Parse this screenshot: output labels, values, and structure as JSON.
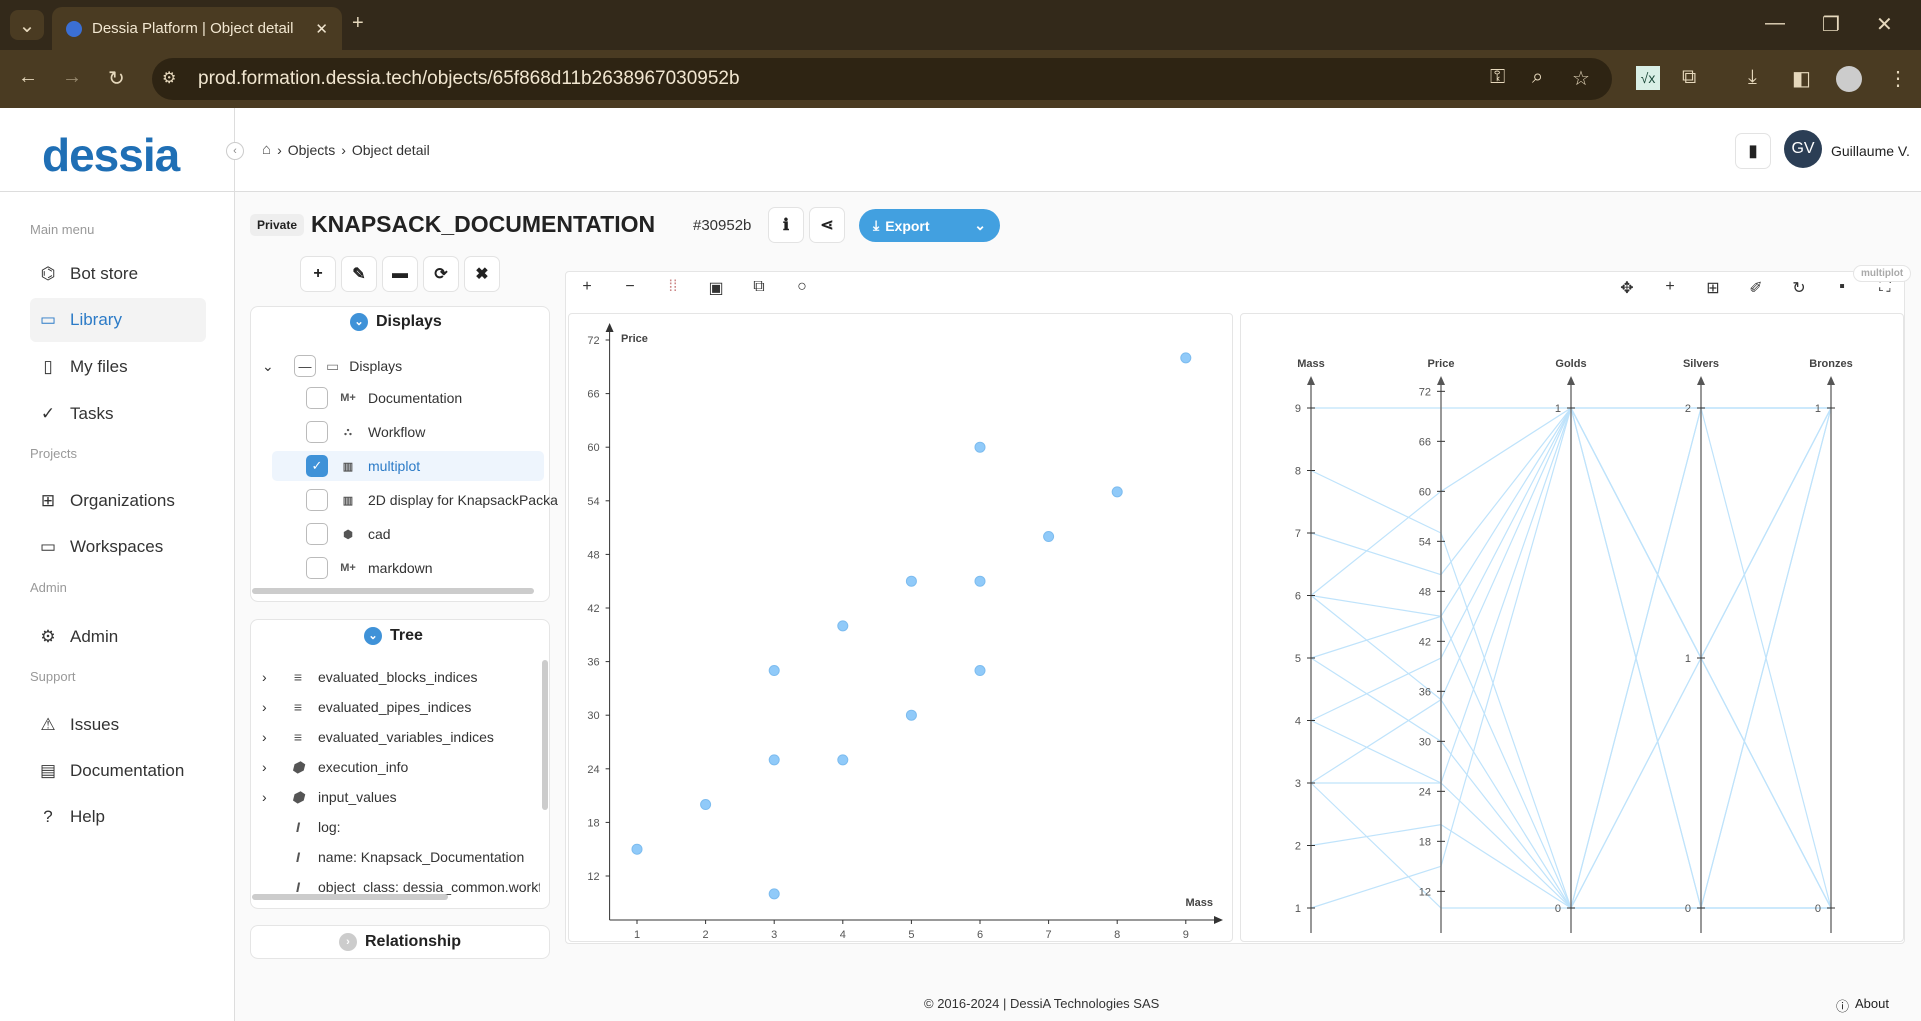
{
  "browser": {
    "tab_title": "Dessia Platform | Object detail",
    "url": "prod.formation.dessia.tech/objects/65f868d11b2638967030952b"
  },
  "header": {
    "logo": "dessia",
    "breadcrumb": [
      "Objects",
      "Object detail"
    ],
    "user_initials": "GV",
    "user_name": "Guillaume V."
  },
  "sidebar": {
    "sections": [
      {
        "title": "Main menu",
        "items": [
          {
            "label": "Bot store",
            "icon": "bot-icon"
          },
          {
            "label": "Library",
            "icon": "folder-icon",
            "active": true
          },
          {
            "label": "My files",
            "icon": "file-icon"
          },
          {
            "label": "Tasks",
            "icon": "check-circle-icon"
          }
        ]
      },
      {
        "title": "Projects",
        "items": [
          {
            "label": "Organizations",
            "icon": "org-icon"
          },
          {
            "label": "Workspaces",
            "icon": "briefcase-icon"
          }
        ]
      },
      {
        "title": "Admin",
        "items": [
          {
            "label": "Admin",
            "icon": "user-gear-icon"
          }
        ]
      },
      {
        "title": "Support",
        "items": [
          {
            "label": "Issues",
            "icon": "warning-icon"
          },
          {
            "label": "Documentation",
            "icon": "book-icon"
          },
          {
            "label": "Help",
            "icon": "help-icon"
          }
        ]
      }
    ]
  },
  "object": {
    "visibility": "Private",
    "title": "KNAPSACK_DOCUMENTATION",
    "short_id": "#30952b",
    "export_label": "Export"
  },
  "displays": {
    "title": "Displays",
    "root": "Displays",
    "items": [
      {
        "label": "Documentation",
        "icon": "M+",
        "checked": false
      },
      {
        "label": "Workflow",
        "icon": "wf",
        "checked": false
      },
      {
        "label": "multiplot",
        "icon": "chart",
        "checked": true
      },
      {
        "label": "2D display for KnapsackPacka",
        "icon": "chart",
        "checked": false
      },
      {
        "label": "cad",
        "icon": "cube",
        "checked": false
      },
      {
        "label": "markdown",
        "icon": "M+",
        "checked": false
      }
    ]
  },
  "tree": {
    "title": "Tree",
    "items": [
      {
        "label": "evaluated_blocks_indices",
        "icon": "list",
        "expandable": true
      },
      {
        "label": "evaluated_pipes_indices",
        "icon": "list",
        "expandable": true
      },
      {
        "label": "evaluated_variables_indices",
        "icon": "list",
        "expandable": true
      },
      {
        "label": "execution_info",
        "icon": "cube",
        "expandable": true
      },
      {
        "label": "input_values",
        "icon": "cube",
        "expandable": true
      },
      {
        "label": "log:",
        "icon": "text",
        "expandable": false
      },
      {
        "label": "name: Knapsack_Documentation",
        "icon": "text",
        "expandable": false
      },
      {
        "label": "object_class: dessia_common.workfl",
        "icon": "text",
        "expandable": false
      }
    ]
  },
  "relationship": {
    "title": "Relationship"
  },
  "plot": {
    "badge": "multiplot",
    "accent": "#42a5f5",
    "point_color": "#90caf9"
  },
  "chart_data": [
    {
      "type": "scatter",
      "xlabel": "Mass",
      "ylabel": "Price",
      "xlim": [
        1,
        9
      ],
      "ylim": [
        10,
        72
      ],
      "xticks": [
        1,
        2,
        3,
        4,
        5,
        6,
        7,
        8,
        9
      ],
      "yticks": [
        12,
        18,
        24,
        30,
        36,
        42,
        48,
        54,
        60,
        66,
        72
      ],
      "x": [
        1,
        2,
        3,
        3,
        3,
        4,
        4,
        5,
        5,
        6,
        6,
        6,
        7,
        8,
        9
      ],
      "y": [
        15,
        20,
        35,
        25,
        10,
        40,
        25,
        45,
        30,
        60,
        45,
        35,
        50,
        55,
        70
      ]
    },
    {
      "type": "parallel-coordinates",
      "axes": [
        {
          "name": "Mass",
          "ticks": [
            1,
            2,
            3,
            4,
            5,
            6,
            7,
            8,
            9
          ],
          "range": [
            1,
            9
          ]
        },
        {
          "name": "Price",
          "ticks": [
            12,
            18,
            24,
            30,
            36,
            42,
            48,
            54,
            60,
            66,
            72
          ],
          "range": [
            10,
            70
          ]
        },
        {
          "name": "Golds",
          "ticks": [
            0,
            1
          ],
          "range": [
            0,
            1
          ]
        },
        {
          "name": "Silvers",
          "ticks": [
            0,
            1,
            2
          ],
          "range": [
            0,
            2
          ]
        },
        {
          "name": "Bronzes",
          "ticks": [
            0,
            1
          ],
          "range": [
            0,
            1
          ]
        }
      ],
      "rows": [
        [
          9,
          70,
          1,
          2,
          1
        ],
        [
          6,
          60,
          1,
          1,
          0
        ],
        [
          8,
          55,
          0,
          2,
          0
        ],
        [
          7,
          50,
          1,
          0,
          1
        ],
        [
          5,
          45,
          1,
          1,
          1
        ],
        [
          6,
          45,
          0,
          1,
          0
        ],
        [
          4,
          40,
          1,
          2,
          1
        ],
        [
          3,
          35,
          1,
          1,
          0
        ],
        [
          6,
          35,
          0,
          0,
          1
        ],
        [
          5,
          30,
          0,
          1,
          1
        ],
        [
          3,
          25,
          1,
          0,
          0
        ],
        [
          4,
          25,
          0,
          2,
          1
        ],
        [
          2,
          20,
          0,
          0,
          0
        ],
        [
          1,
          15,
          1,
          1,
          1
        ],
        [
          3,
          10,
          0,
          0,
          0
        ]
      ]
    }
  ],
  "footer": {
    "copyright": "© 2016-2024 | DessiA Technologies SAS",
    "about": "About"
  }
}
